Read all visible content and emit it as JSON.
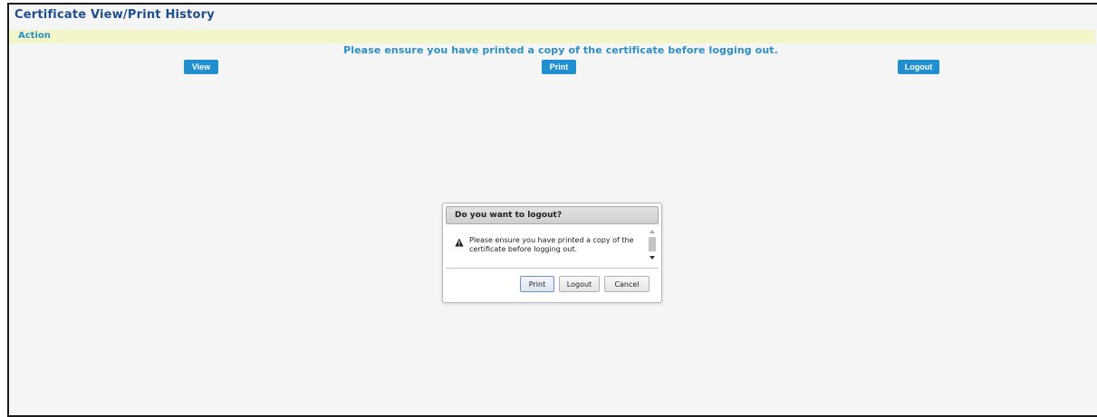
{
  "page": {
    "title": "Certificate View/Print History",
    "action_label": "Action",
    "notice": "Please ensure you have printed a copy of the certificate before logging out."
  },
  "buttons": {
    "view": "View",
    "print": "Print",
    "logout": "Logout"
  },
  "dialog": {
    "title": "Do you want to logout?",
    "message": "Please ensure you have printed a copy of the certificate before logging out.",
    "icon": "warning-icon",
    "buttons": {
      "print": "Print",
      "logout": "Logout",
      "cancel": "Cancel"
    }
  },
  "colors": {
    "title": "#1e4e8c",
    "accent": "#2a8fc4",
    "button_blue": "#1f8fd0",
    "action_bar": "#f2f5c8",
    "background": "#f5f5f5"
  }
}
